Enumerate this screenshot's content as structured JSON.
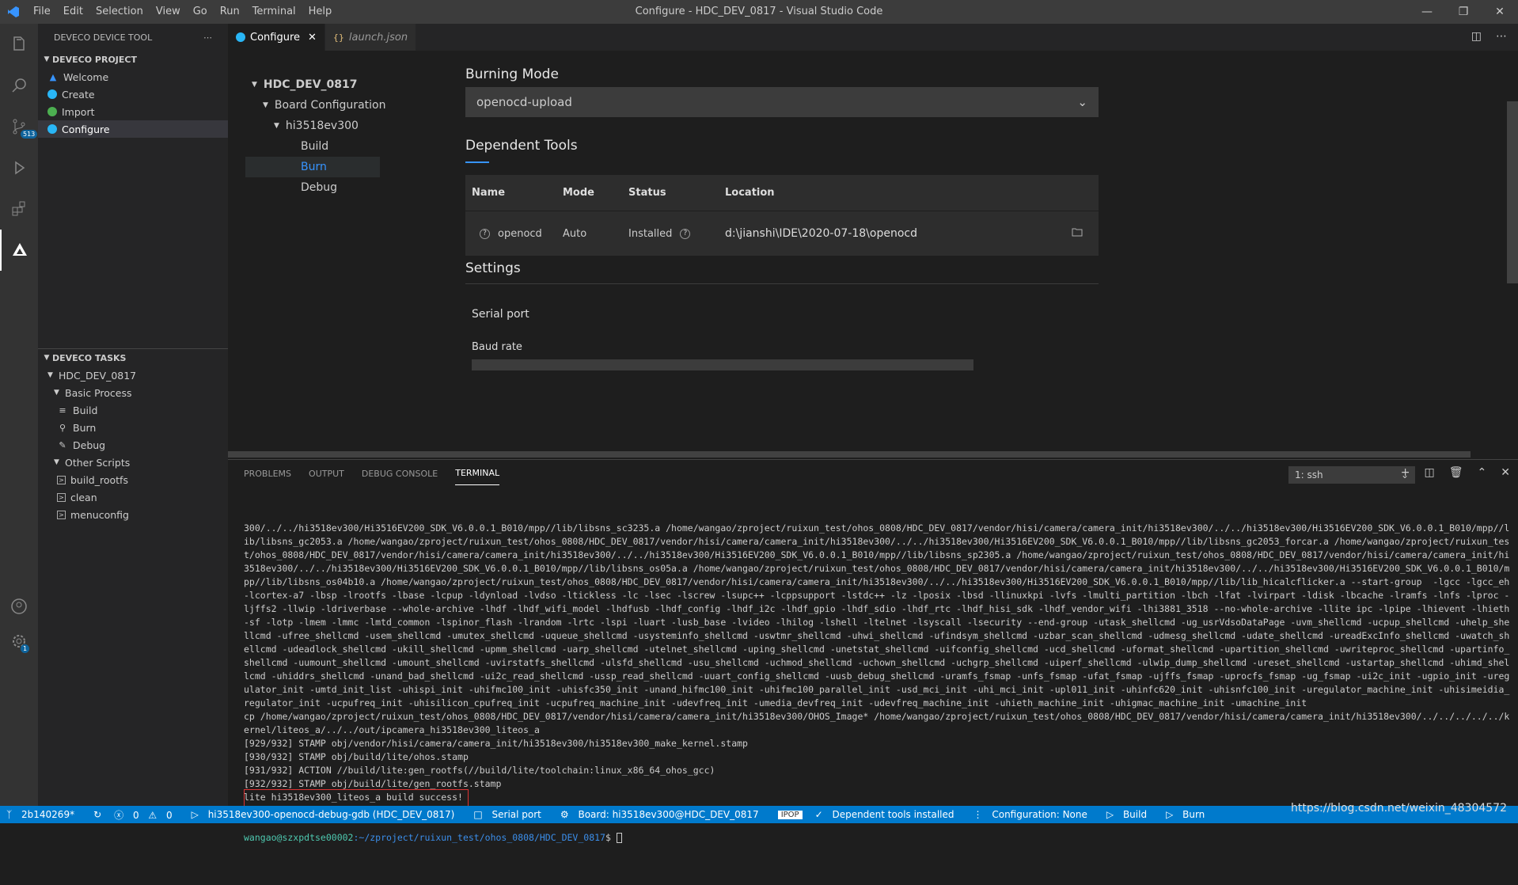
{
  "app": {
    "window_title": "Configure - HDC_DEV_0817 - Visual Studio Code",
    "menu": [
      "File",
      "Edit",
      "Selection",
      "View",
      "Go",
      "Run",
      "Terminal",
      "Help"
    ]
  },
  "activity": {
    "scm_badge": "513",
    "settings_badge": "1"
  },
  "sidebar": {
    "title": "DEVECO DEVICE TOOL",
    "project_section": "DEVECO PROJECT",
    "project_items": [
      {
        "label": "Welcome",
        "color": "#3794ff"
      },
      {
        "label": "Create",
        "color": "#29b6f6"
      },
      {
        "label": "Import",
        "color": "#4caf50"
      },
      {
        "label": "Configure",
        "color": "#29b6f6"
      }
    ],
    "tasks_section": "DEVECO TASKS",
    "tasks_root": "HDC_DEV_0817",
    "basic_process": "Basic Process",
    "basic_items": [
      "Build",
      "Burn",
      "Debug"
    ],
    "other_scripts": "Other Scripts",
    "other_items": [
      "build_rootfs",
      "clean",
      "menuconfig"
    ]
  },
  "tabs": [
    {
      "label": "Configure"
    },
    {
      "label": "launch.json"
    }
  ],
  "tree": {
    "root": "HDC_DEV_0817",
    "board": "Board Configuration",
    "chip": "hi3518ev300",
    "items": [
      "Build",
      "Burn",
      "Debug"
    ]
  },
  "config": {
    "burning_mode_title": "Burning Mode",
    "burning_mode_value": "openocd-upload",
    "dep_tools_title": "Dependent Tools",
    "columns": [
      "Name",
      "Mode",
      "Status",
      "Location"
    ],
    "row": {
      "name": "openocd",
      "mode": "Auto",
      "status": "Installed",
      "location": "d:\\jianshi\\IDE\\2020-07-18\\openocd"
    },
    "settings_title": "Settings",
    "serial_port": "Serial port",
    "baud_rate": "Baud rate"
  },
  "panel": {
    "tabs": [
      "PROBLEMS",
      "OUTPUT",
      "DEBUG CONSOLE",
      "TERMINAL"
    ],
    "terminal_select": "1: ssh",
    "log": "300/../../hi3518ev300/Hi3516EV200_SDK_V6.0.0.1_B010/mpp//lib/libsns_sc3235.a /home/wangao/zproject/ruixun_test/ohos_0808/HDC_DEV_0817/vendor/hisi/camera/camera_init/hi3518ev300/../../hi3518ev300/Hi3516EV200_SDK_V6.0.0.1_B010/mpp//lib/libsns_gc2053.a /home/wangao/zproject/ruixun_test/ohos_0808/HDC_DEV_0817/vendor/hisi/camera/camera_init/hi3518ev300/../../hi3518ev300/Hi3516EV200_SDK_V6.0.0.1_B010/mpp//lib/libsns_gc2053_forcar.a /home/wangao/zproject/ruixun_test/ohos_0808/HDC_DEV_0817/vendor/hisi/camera/camera_init/hi3518ev300/../../hi3518ev300/Hi3516EV200_SDK_V6.0.0.1_B010/mpp//lib/libsns_sp2305.a /home/wangao/zproject/ruixun_test/ohos_0808/HDC_DEV_0817/vendor/hisi/camera/camera_init/hi3518ev300/../../hi3518ev300/Hi3516EV200_SDK_V6.0.0.1_B010/mpp//lib/libsns_os05a.a /home/wangao/zproject/ruixun_test/ohos_0808/HDC_DEV_0817/vendor/hisi/camera/camera_init/hi3518ev300/../../hi3518ev300/Hi3516EV200_SDK_V6.0.0.1_B010/mpp//lib/libsns_os04b10.a /home/wangao/zproject/ruixun_test/ohos_0808/HDC_DEV_0817/vendor/hisi/camera/camera_init/hi3518ev300/../../hi3518ev300/Hi3516EV200_SDK_V6.0.0.1_B010/mpp//lib/lib_hicalcflicker.a --start-group  -lgcc -lgcc_eh -lcortex-a7 -lbsp -lrootfs -lbase -lcpup -ldynload -lvdso -ltickless -lc -lsec -lscrew -lsupc++ -lcppsupport -lstdc++ -lz -lposix -lbsd -llinuxkpi -lvfs -lmulti_partition -lbch -lfat -lvirpart -ldisk -lbcache -lramfs -lnfs -lproc -ljffs2 -llwip -ldriverbase --whole-archive -lhdf -lhdf_wifi_model -lhdfusb -lhdf_config -lhdf_i2c -lhdf_gpio -lhdf_sdio -lhdf_rtc -lhdf_hisi_sdk -lhdf_vendor_wifi -lhi3881_3518 --no-whole-archive -llite ipc -lpipe -lhievent -lhieth-sf -lotp -lmem -lmmc -lmtd_common -lspinor_flash -lrandom -lrtc -lspi -luart -lusb_base -lvideo -lhilog -lshell -ltelnet -lsyscall -lsecurity --end-group -utask_shellcmd -ug_usrVdsoDataPage -uvm_shellcmd -ucpup_shellcmd -uhelp_shellcmd -ufree_shellcmd -usem_shellcmd -umutex_shellcmd -uqueue_shellcmd -usysteminfo_shellcmd -uswtmr_shellcmd -uhwi_shellcmd -ufindsym_shellcmd -uzbar_scan_shellcmd -udmesg_shellcmd -udate_shellcmd -ureadExcInfo_shellcmd -uwatch_shellcmd -udeadlock_shellcmd -ukill_shellcmd -upmm_shellcmd -uarp_shellcmd -utelnet_shellcmd -uping_shellcmd -unetstat_shellcmd -uifconfig_shellcmd -ucd_shellcmd -uformat_shellcmd -upartition_shellcmd -uwriteproc_shellcmd -upartinfo_shellcmd -uumount_shellcmd -umount_shellcmd -uvirstatfs_shellcmd -ulsfd_shellcmd -usu_shellcmd -uchmod_shellcmd -uchown_shellcmd -uchgrp_shellcmd -uiperf_shellcmd -ulwip_dump_shellcmd -ureset_shellcmd -ustartap_shellcmd -uhimd_shellcmd -uhiddrs_shellcmd -unand_bad_shellcmd -ui2c_read_shellcmd -ussp_read_shellcmd -uuart_config_shellcmd -uusb_debug_shellcmd -uramfs_fsmap -unfs_fsmap -ufat_fsmap -ujffs_fsmap -uprocfs_fsmap -ug_fsmap -ui2c_init -ugpio_init -uregulator_init -umtd_init_list -uhispi_init -uhifmc100_init -uhisfc350_init -unand_hifmc100_init -uhifmc100_parallel_init -usd_mci_init -uhi_mci_init -upl011_init -uhinfc620_init -uhisnfc100_init -uregulator_machine_init -uhisimeidia_regulator_init -ucpufreq_init -uhisilicon_cpufreq_init -ucpufreq_machine_init -udevfreq_init -umedia_devfreq_init -udevfreq_machine_init -uhieth_machine_init -uhigmac_machine_init -umachine_init\ncp /home/wangao/zproject/ruixun_test/ohos_0808/HDC_DEV_0817/vendor/hisi/camera/camera_init/hi3518ev300/OHOS_Image* /home/wangao/zproject/ruixun_test/ohos_0808/HDC_DEV_0817/vendor/hisi/camera/camera_init/hi3518ev300/../../../../../kernel/liteos_a/../../out/ipcamera_hi3518ev300_liteos_a\n[929/932] STAMP obj/vendor/hisi/camera/camera_init/hi3518ev300/hi3518ev300_make_kernel.stamp\n[930/932] STAMP obj/build/lite/ohos.stamp\n[931/932] ACTION //build/lite:gen_rootfs(//build/lite/toolchain:linux_x86_64_ohos_gcc)\n[932/932] STAMP obj/build/lite/gen_rootfs.stamp\nlite hi3518ev300_liteos_a build success!",
    "prompt_user": "wangao@szxpdtse00002",
    "prompt_path": ":~/zproject/ruixun_test/ohos_0808/HDC_DEV_0817",
    "prompt_sym": "$"
  },
  "status": {
    "branch": "2b140269*",
    "errors": "0",
    "warnings": "0",
    "debug_config": "hi3518ev300-openocd-debug-gdb (HDC_DEV_0817)",
    "serial": "Serial port",
    "board": "Board: hi3518ev300@HDC_DEV_0817",
    "ime": "IPOP",
    "deps": "Dependent tools installed",
    "configuration": "Configuration: None",
    "build": "Build",
    "burn": "Burn"
  },
  "watermark": "https://blog.csdn.net/weixin_48304572"
}
